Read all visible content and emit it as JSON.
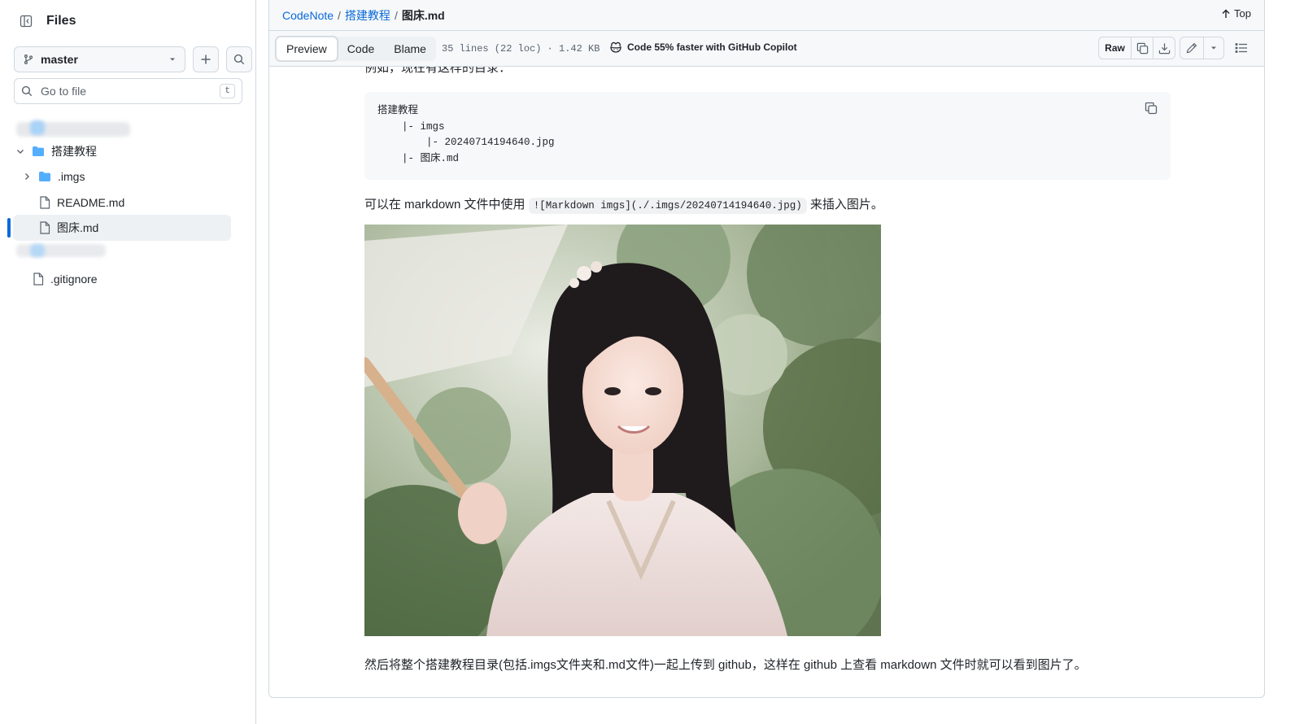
{
  "sidebar": {
    "title": "Files",
    "branch": "master",
    "goto_placeholder": "Go to file",
    "goto_shortcut": "t",
    "tree": {
      "folder_name": "搭建教程",
      "imgs_folder": ".imgs",
      "readme": "README.md",
      "current_file": "图床.md",
      "gitignore": ".gitignore"
    }
  },
  "breadcrumb": {
    "repo": "CodeNote",
    "folder": "搭建教程",
    "file": "图床.md",
    "top_label": "Top"
  },
  "toolbar": {
    "tabs": [
      "Preview",
      "Code",
      "Blame"
    ],
    "file_meta": "35 lines (22 loc) · 1.42 KB",
    "copilot": "Code 55% faster with GitHub Copilot",
    "raw": "Raw"
  },
  "content": {
    "intro": "例如，现在有这样的目录：",
    "code_lines": [
      "搭建教程",
      "    |- imgs",
      "        |- 20240714194640.jpg",
      "    |- 图床.md"
    ],
    "para1_before": "可以在 markdown 文件中使用 ",
    "para1_code": "![Markdown imgs](./.imgs/20240714194640.jpg)",
    "para1_after": " 来插入图片。",
    "para2": "然后将整个搭建教程目录(包括.imgs文件夹和.md文件)一起上传到 github，这样在 github 上查看 markdown 文件时就可以看到图片了。"
  },
  "colors": {
    "accent": "#0969da",
    "folder": "#54aeff",
    "border": "#d1d9e0",
    "muted": "#59636e"
  }
}
